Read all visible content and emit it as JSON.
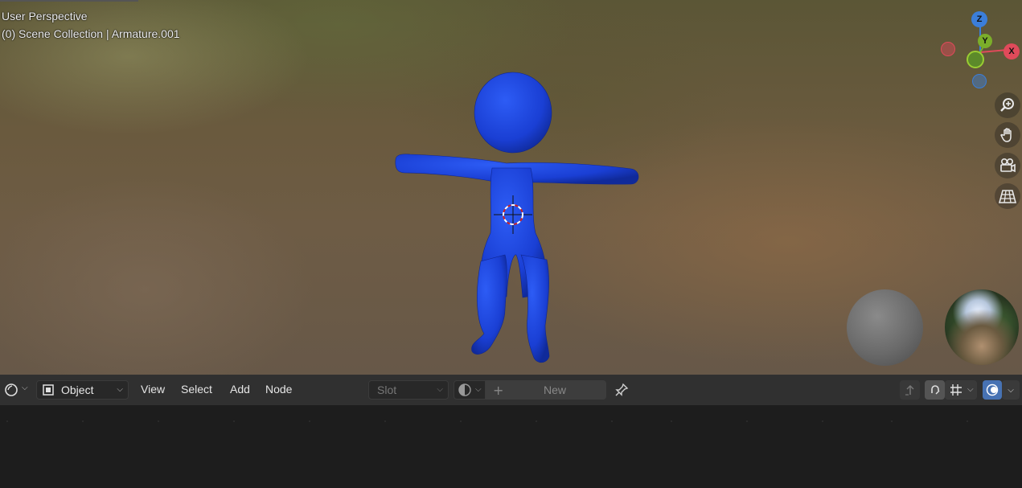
{
  "viewport": {
    "perspective_label": "User Perspective",
    "collection_label": "(0) Scene Collection | Armature.001"
  },
  "gizmo": {
    "axes": [
      {
        "label": "Z",
        "color": "#3b7ed9"
      },
      {
        "label": "Y",
        "color": "#7bae2a"
      },
      {
        "label": "X",
        "color": "#e04a5a"
      }
    ]
  },
  "nav_icons": [
    "zoom-icon",
    "hand-pan-icon",
    "camera-icon",
    "grid-perspective-icon"
  ],
  "header": {
    "editor_type_icon": "node-editor-icon",
    "mode": "Object",
    "menus": [
      "View",
      "Select",
      "Add",
      "Node"
    ],
    "slot_placeholder": "Slot",
    "new_label": "New",
    "icons": {
      "plus": "+",
      "pin": "pin-icon",
      "parent": "parent-icon",
      "snap": "snap-icon",
      "grid": "grid-icon",
      "overlay": "overlay-icon"
    }
  },
  "colors": {
    "figure_blue": "#1a3fd4",
    "header_bg": "#303030",
    "accent_blue": "#4772b3"
  }
}
